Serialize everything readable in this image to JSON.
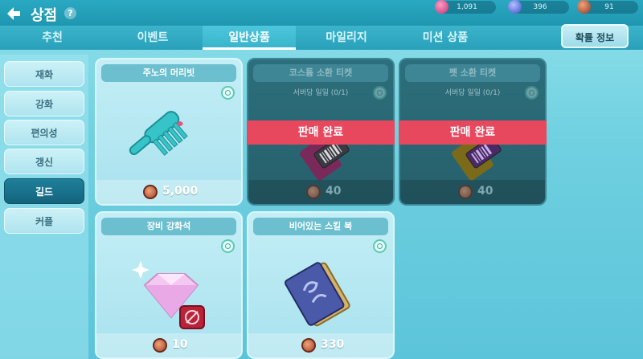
{
  "header": {
    "title": "상점",
    "help_icon": "question-icon",
    "currencies": [
      {
        "name": "pink-gem-icon",
        "value": "1,091",
        "color": "#e05a9a"
      },
      {
        "name": "blue-gem-icon",
        "value": "396",
        "color": "#5a6cd8"
      },
      {
        "name": "copper-coin-icon",
        "value": "91",
        "color": "#b5533a"
      }
    ]
  },
  "tabs": [
    {
      "label": "추천"
    },
    {
      "label": "이벤트"
    },
    {
      "label": "일반상품",
      "active": true
    },
    {
      "label": "마일리지"
    },
    {
      "label": "미션 상품"
    }
  ],
  "rate_button": "확률 정보",
  "sidebar": {
    "items": [
      {
        "label": "재화"
      },
      {
        "label": "강화"
      },
      {
        "label": "편의성"
      },
      {
        "label": "갱신"
      },
      {
        "label": "길드",
        "active": true
      },
      {
        "label": "커플"
      }
    ]
  },
  "cards": [
    {
      "name": "주노의 머리빗",
      "limit": "",
      "price": "5,000",
      "sold": false,
      "icon": "comb-icon"
    },
    {
      "name": "코스튬 소환 티켓",
      "limit": "서버당 일일 (0/1)",
      "price": "40",
      "sold": true,
      "sold_label": "판매 완료",
      "icon": "costume-ticket-icon"
    },
    {
      "name": "펫 소환 티켓",
      "limit": "서버당 일일 (0/1)",
      "price": "40",
      "sold": true,
      "sold_label": "판매 완료",
      "icon": "pet-ticket-icon"
    },
    {
      "name": "장비 강화석",
      "limit": "",
      "price": "10",
      "sold": false,
      "icon": "enhance-stone-icon"
    },
    {
      "name": "비어있는 스킬 북",
      "limit": "",
      "price": "330",
      "sold": false,
      "icon": "skill-book-icon"
    }
  ]
}
